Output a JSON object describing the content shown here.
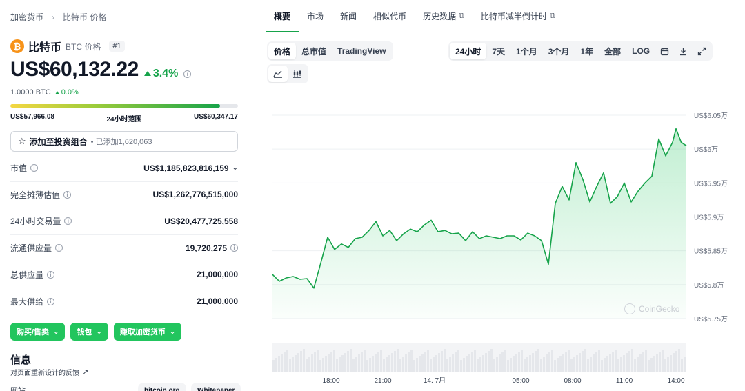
{
  "breadcrumb": {
    "root": "加密货币",
    "current": "比特币 价格"
  },
  "coin": {
    "logo": "₿",
    "name": "比特币",
    "symbol": "BTC 价格",
    "rank": "#1"
  },
  "price": {
    "value": "US$60,132.22",
    "change": "3.4%",
    "change_color": "#16a34a"
  },
  "btc_price": {
    "value": "1.0000 BTC",
    "change": "0.0%"
  },
  "range": {
    "low": "US$57,966.08",
    "label": "24小时范围",
    "high": "US$60,347.17",
    "position": 0.92
  },
  "portfolio": {
    "label": "添加至投资组合",
    "added": "• 已添加1,620,063"
  },
  "stats": [
    {
      "label": "市值",
      "value": "US$1,185,823,816,159",
      "dropdown": true
    },
    {
      "label": "完全摊薄估值",
      "value": "US$1,262,776,515,000"
    },
    {
      "label": "24小时交易量",
      "value": "US$20,477,725,558"
    },
    {
      "label": "流通供应量",
      "value": "19,720,275",
      "info": true
    },
    {
      "label": "总供应量",
      "value": "21,000,000"
    },
    {
      "label": "最大供给",
      "value": "21,000,000"
    }
  ],
  "buttons": {
    "buy": "购买/售卖",
    "wallet": "钱包",
    "earn": "赚取加密货币"
  },
  "info": {
    "title": "信息",
    "feedback": "对页面重新设计的反馈",
    "website_label": "网站",
    "links": [
      "bitcoin.org",
      "Whitepaper"
    ]
  },
  "tabs": [
    {
      "label": "概要",
      "active": true
    },
    {
      "label": "市场"
    },
    {
      "label": "新闻"
    },
    {
      "label": "相似代币"
    },
    {
      "label": "历史数据",
      "external": true
    },
    {
      "label": "比特币减半倒计时",
      "external": true
    }
  ],
  "chart_types": [
    "价格",
    "总市值",
    "TradingView"
  ],
  "time_ranges": [
    "24小时",
    "7天",
    "1个月",
    "3个月",
    "1年",
    "全部",
    "LOG"
  ],
  "icons": {
    "calendar": "calendar-icon",
    "download": "download-icon",
    "expand": "expand-icon",
    "line": "line-chart-icon",
    "candle": "candlestick-icon",
    "info": "info-icon",
    "star": "star-icon",
    "external": "external-link-icon"
  },
  "watermark": "CoinGecko",
  "colors": {
    "accent": "#16a34a",
    "button": "#22c55e",
    "btc": "#f7931a"
  },
  "chart_data": {
    "type": "area",
    "y_labels": [
      "US$6.05万",
      "US$6万",
      "US$5.95万",
      "US$5.9万",
      "US$5.85万",
      "US$5.8万",
      "US$5.75万"
    ],
    "y_values": [
      60500,
      60000,
      59500,
      59000,
      58500,
      58000,
      57500
    ],
    "ylim": [
      57500,
      60500
    ],
    "x_labels": [
      "18:00",
      "21:00",
      "14. 7月",
      "05:00",
      "08:00",
      "11:00",
      "14:00"
    ],
    "x_hours": [
      0,
      3,
      6,
      11,
      14,
      17,
      20
    ],
    "xlim": [
      -3.4,
      20.6
    ],
    "series": [
      {
        "color": "#16a34a",
        "x": [
          -3.4,
          -3.0,
          -2.6,
          -2.2,
          -1.8,
          -1.4,
          -1.0,
          -0.6,
          -0.2,
          0.2,
          0.6,
          1.0,
          1.4,
          1.8,
          2.2,
          2.6,
          3.0,
          3.4,
          3.8,
          4.2,
          4.6,
          5.0,
          5.4,
          5.8,
          6.2,
          6.6,
          7.0,
          7.4,
          7.8,
          8.2,
          8.6,
          9.0,
          9.4,
          9.8,
          10.2,
          10.6,
          11.0,
          11.4,
          11.8,
          12.2,
          12.6,
          13.0,
          13.4,
          13.8,
          14.2,
          14.6,
          15.0,
          15.4,
          15.8,
          16.2,
          16.6,
          17.0,
          17.4,
          17.8,
          18.2,
          18.6,
          19.0,
          19.4,
          19.8,
          20.0,
          20.3,
          20.6
        ],
        "values": [
          58150,
          58050,
          58100,
          58120,
          58080,
          58090,
          57950,
          58320,
          58700,
          58520,
          58600,
          58550,
          58680,
          58700,
          58800,
          58930,
          58720,
          58800,
          58650,
          58750,
          58820,
          58780,
          58880,
          58950,
          58780,
          58800,
          58750,
          58760,
          58650,
          58780,
          58680,
          58720,
          58700,
          58680,
          58720,
          58720,
          58660,
          58760,
          58720,
          58650,
          58300,
          59200,
          59450,
          59250,
          59800,
          59550,
          59220,
          59450,
          59650,
          59200,
          59300,
          59500,
          59220,
          59380,
          59500,
          59600,
          60150,
          59900,
          60100,
          60300,
          60100,
          60050
        ]
      }
    ]
  }
}
